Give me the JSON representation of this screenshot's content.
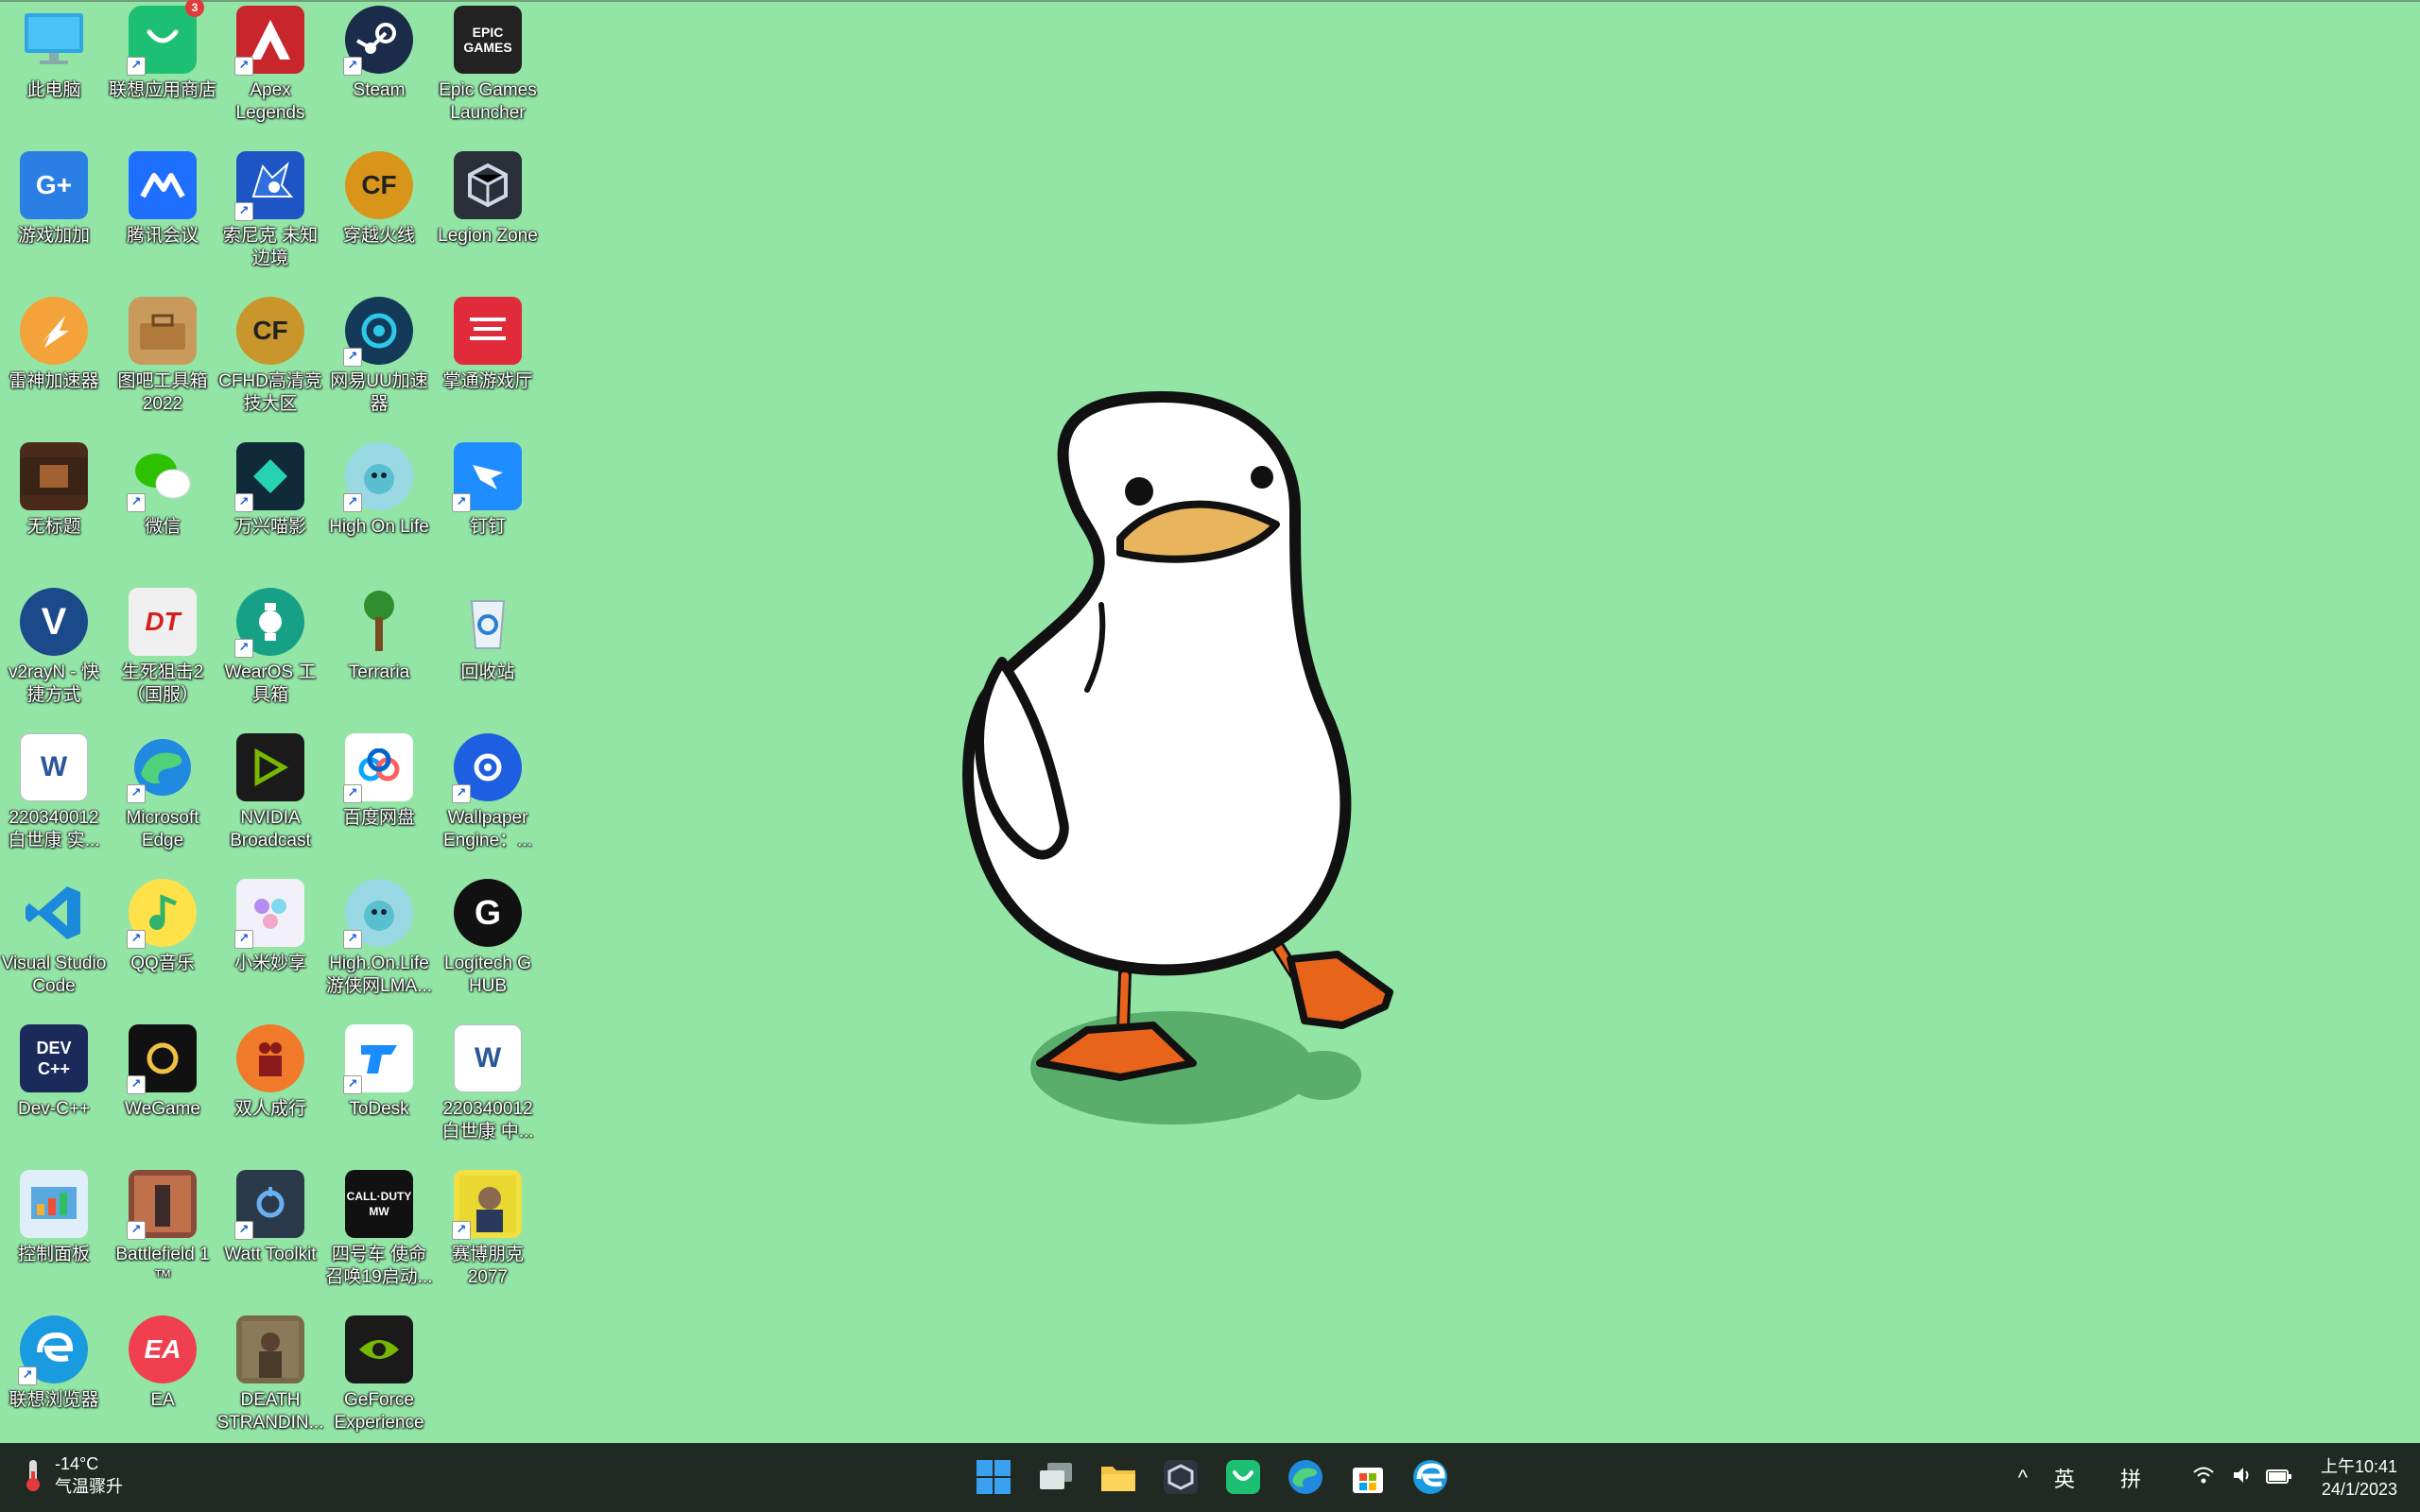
{
  "desktop": {
    "icons": [
      {
        "label": "此电脑"
      },
      {
        "label": "联想应用商店",
        "badge": "3"
      },
      {
        "label": "Apex Legends"
      },
      {
        "label": "Steam"
      },
      {
        "label": "Epic Games Launcher",
        "icon_text": "EPIC GAMES"
      },
      {
        "label": "游戏加加",
        "icon_text": "G+"
      },
      {
        "label": "腾讯会议"
      },
      {
        "label": "索尼克 未知边境"
      },
      {
        "label": "穿越火线",
        "icon_text": "CF"
      },
      {
        "label": "Legion Zone"
      },
      {
        "label": "雷神加速器"
      },
      {
        "label": "图吧工具箱2022"
      },
      {
        "label": "CFHD高清竞技大区",
        "icon_text": "CF"
      },
      {
        "label": "网易UU加速器"
      },
      {
        "label": "掌通游戏厅"
      },
      {
        "label": "无标题"
      },
      {
        "label": "微信"
      },
      {
        "label": "万兴喵影"
      },
      {
        "label": "High On Life"
      },
      {
        "label": "钉钉"
      },
      {
        "label": "v2rayN - 快捷方式",
        "icon_text": "V"
      },
      {
        "label": "生死狙击2（国服）",
        "icon_text": "DT"
      },
      {
        "label": "WearOS 工具箱"
      },
      {
        "label": "Terraria"
      },
      {
        "label": "回收站"
      },
      {
        "label": "220340012 白世康 实...",
        "icon_text": "W"
      },
      {
        "label": "Microsoft Edge"
      },
      {
        "label": "NVIDIA Broadcast"
      },
      {
        "label": "百度网盘"
      },
      {
        "label": "Wallpaper Engine：..."
      },
      {
        "label": "Visual Studio Code"
      },
      {
        "label": "QQ音乐"
      },
      {
        "label": "小米妙享"
      },
      {
        "label": "High.On.Life 游侠网LMA..."
      },
      {
        "label": "Logitech G HUB",
        "icon_text": "G"
      },
      {
        "label": "Dev-C++",
        "icon_text": "DEV C++"
      },
      {
        "label": "WeGame"
      },
      {
        "label": "双人成行"
      },
      {
        "label": "ToDesk"
      },
      {
        "label": "220340012 白世康 中...",
        "icon_text": "W"
      },
      {
        "label": "控制面板"
      },
      {
        "label": "Battlefield 1 ™"
      },
      {
        "label": "Watt Toolkit"
      },
      {
        "label": "四号车 使命召唤19启动...",
        "icon_text": "CALL·DUTY MW"
      },
      {
        "label": "赛博朋克 2077"
      },
      {
        "label": "联想浏览器"
      },
      {
        "label": "EA",
        "icon_text": "EA"
      },
      {
        "label": "DEATH STRANDIN..."
      },
      {
        "label": "GeForce Experience"
      }
    ]
  },
  "weather": {
    "temp": "-14°C",
    "desc": "气温骤升"
  },
  "taskbar": {
    "apps": [
      "start",
      "task-view",
      "file-explorer",
      "legion-zone",
      "lenovo-store",
      "edge",
      "microsoft-store",
      "lenovo-browser"
    ]
  },
  "tray": {
    "lang": "英",
    "ime": "拼",
    "time": "上午10:41",
    "date": "24/1/2023"
  }
}
